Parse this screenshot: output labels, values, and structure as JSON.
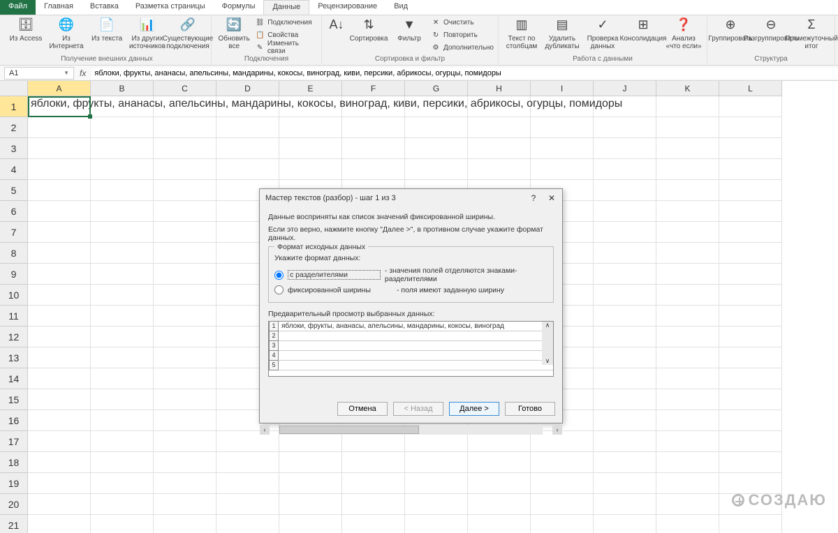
{
  "ribbon_tabs": {
    "file": "Файл",
    "items": [
      "Главная",
      "Вставка",
      "Разметка страницы",
      "Формулы",
      "Данные",
      "Рецензирование",
      "Вид"
    ],
    "active": "Данные"
  },
  "ribbon": {
    "group_external": {
      "label": "Получение внешних данных",
      "btns": [
        "Из Access",
        "Из Интернета",
        "Из текста",
        "Из других источников",
        "Существующие подключения"
      ]
    },
    "group_connections": {
      "label": "Подключения",
      "refresh": "Обновить все",
      "small": [
        "Подключения",
        "Свойства",
        "Изменить связи"
      ]
    },
    "group_sortfilter": {
      "label": "Сортировка и фильтр",
      "sort": "Сортировка",
      "filter": "Фильтр",
      "small": [
        "Очистить",
        "Повторить",
        "Дополнительно"
      ]
    },
    "group_datawork": {
      "label": "Работа с данными",
      "btns": [
        "Текст по столбцам",
        "Удалить дубликаты",
        "Проверка данных",
        "Консолидация",
        "Анализ «что если»"
      ]
    },
    "group_structure": {
      "label": "Структура",
      "btns": [
        "Группировать",
        "Разгруппировать",
        "Промежуточный итог"
      ]
    }
  },
  "namebox": "A1",
  "formula": "яблоки, фрукты, ананасы, апельсины, мандарины, кокосы, виноград, киви, персики, абрикосы, огурцы, помидоры",
  "columns": [
    "A",
    "B",
    "C",
    "D",
    "E",
    "F",
    "G",
    "H",
    "I",
    "J",
    "K",
    "L"
  ],
  "row_count": 21,
  "cell_a1": "яблоки, фрукты, ананасы, апельсины, мандарины, кокосы, виноград, киви, персики, абрикосы, огурцы, помидоры",
  "dialog": {
    "title": "Мастер текстов (разбор) - шаг 1 из 3",
    "desc1": "Данные восприняты как список значений фиксированной ширины.",
    "desc2": "Если это верно, нажмите кнопку \"Далее >\", в противном случае укажите формат данных.",
    "fieldset": "Формат исходных данных",
    "prompt": "Укажите формат данных:",
    "radio1": "с разделителями",
    "radio1_desc": "- значения полей отделяются знаками-разделителями",
    "radio2": "фиксированной ширины",
    "radio2_desc": "- поля имеют заданную ширину",
    "preview_label": "Предварительный просмотр выбранных данных:",
    "preview_line1": "яблоки, фрукты, ананасы, апельсины, мандарины, кокосы, виноград",
    "buttons": {
      "cancel": "Отмена",
      "back": "< Назад",
      "next": "Далее >",
      "finish": "Готово"
    }
  },
  "watermark": "СОЗДАЮ"
}
